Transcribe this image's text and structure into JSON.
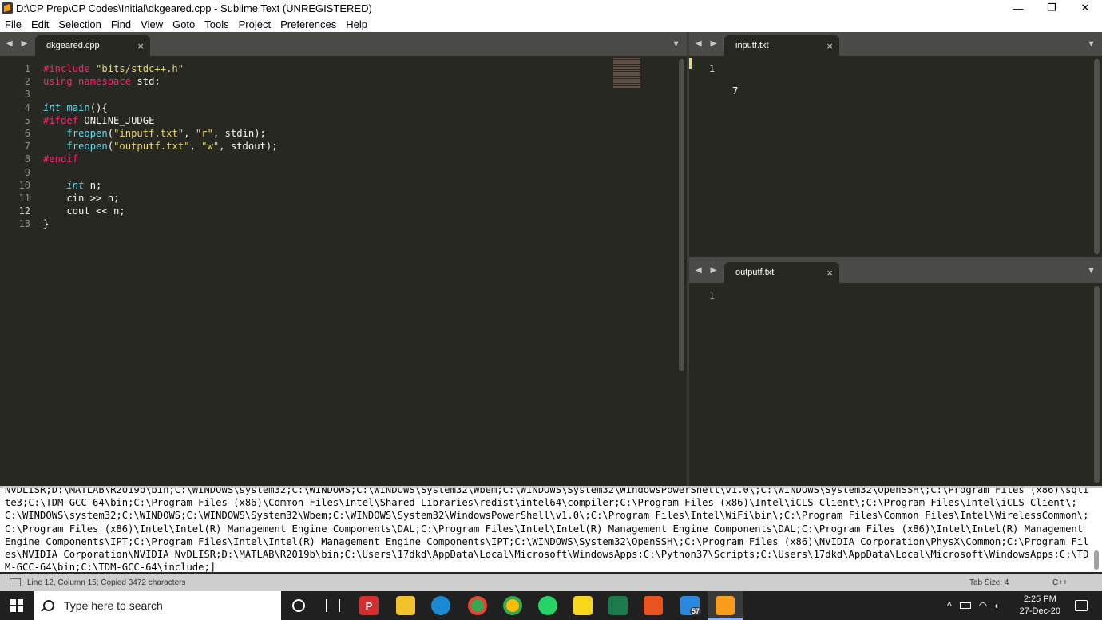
{
  "window": {
    "title": "D:\\CP Prep\\CP Codes\\Initial\\dkgeared.cpp - Sublime Text (UNREGISTERED)",
    "minimize": "—",
    "maximize": "❐",
    "close": "✕"
  },
  "menu": [
    "File",
    "Edit",
    "Selection",
    "Find",
    "View",
    "Goto",
    "Tools",
    "Project",
    "Preferences",
    "Help"
  ],
  "left_pane": {
    "nav": "◀ ▶",
    "tab_label": "dkgeared.cpp",
    "tab_close": "×",
    "dropdown": "▼",
    "line_numbers": [
      "1",
      "2",
      "3",
      "4",
      "5",
      "6",
      "7",
      "8",
      "9",
      "10",
      "11",
      "12",
      "13"
    ],
    "active_line": 12
  },
  "input_pane": {
    "nav": "◀ ▶",
    "tab_label": "inputf.txt",
    "tab_close": "×",
    "dropdown": "▼",
    "line_numbers": [
      "1"
    ],
    "content": "7"
  },
  "output_pane": {
    "nav": "◀ ▶",
    "tab_label": "outputf.txt",
    "tab_close": "×",
    "dropdown": "▼",
    "line_numbers": [
      "1"
    ],
    "content": ""
  },
  "code_lines": [
    [
      {
        "t": "#include ",
        "c": "pp"
      },
      {
        "t": "\"bits/stdc++.h\"",
        "c": "st"
      }
    ],
    [
      {
        "t": "using ",
        "c": "kw"
      },
      {
        "t": "namespace ",
        "c": "kw"
      },
      {
        "t": "std;",
        "c": ""
      }
    ],
    [],
    [
      {
        "t": "int",
        "c": "ty"
      },
      {
        "t": " ",
        "c": ""
      },
      {
        "t": "main",
        "c": "fn"
      },
      {
        "t": "(){",
        "c": ""
      }
    ],
    [
      {
        "t": "#ifdef ",
        "c": "pp"
      },
      {
        "t": "ONLINE_JUDGE",
        "c": ""
      }
    ],
    [
      {
        "t": "    ",
        "c": ""
      },
      {
        "t": "freopen",
        "c": "fn"
      },
      {
        "t": "(",
        "c": ""
      },
      {
        "t": "\"inputf.txt\"",
        "c": "st"
      },
      {
        "t": ", ",
        "c": ""
      },
      {
        "t": "\"r\"",
        "c": "st"
      },
      {
        "t": ", stdin);",
        "c": ""
      }
    ],
    [
      {
        "t": "    ",
        "c": ""
      },
      {
        "t": "freopen",
        "c": "fn"
      },
      {
        "t": "(",
        "c": ""
      },
      {
        "t": "\"outputf.txt\"",
        "c": "st"
      },
      {
        "t": ", ",
        "c": ""
      },
      {
        "t": "\"w\"",
        "c": "st"
      },
      {
        "t": ", stdout);",
        "c": ""
      }
    ],
    [
      {
        "t": "#endif",
        "c": "pp"
      }
    ],
    [],
    [
      {
        "t": "    ",
        "c": ""
      },
      {
        "t": "int",
        "c": "ty"
      },
      {
        "t": " n;",
        "c": ""
      }
    ],
    [
      {
        "t": "    cin >> n;",
        "c": ""
      }
    ],
    [
      {
        "t": "    cout << n;",
        "c": ""
      }
    ],
    [
      {
        "t": "}",
        "c": ""
      }
    ]
  ],
  "console": {
    "text": "NvDLISR;D:\\MATLAB\\R2019b\\bin;C:\\WINDOWS\\system32;C:\\WINDOWS;C:\\WINDOWS\\System32\\Wbem;C:\\WINDOWS\\System32\\WindowsPowerShell\\v1.0\\;C:\\WINDOWS\\System32\\OpenSSH\\;C:\\Program Files (x86)\\sqlite3;C:\\TDM-GCC-64\\bin;C:\\Program Files (x86)\\Common Files\\Intel\\Shared Libraries\\redist\\intel64\\compiler;C:\\Program Files (x86)\\Intel\\iCLS Client\\;C:\\Program Files\\Intel\\iCLS Client\\;C:\\WINDOWS\\system32;C:\\WINDOWS;C:\\WINDOWS\\System32\\Wbem;C:\\WINDOWS\\System32\\WindowsPowerShell\\v1.0\\;C:\\Program Files\\Intel\\WiFi\\bin\\;C:\\Program Files\\Common Files\\Intel\\WirelessCommon\\;C:\\Program Files (x86)\\Intel\\Intel(R) Management Engine Components\\DAL;C:\\Program Files\\Intel\\Intel(R) Management Engine Components\\DAL;C:\\Program Files (x86)\\Intel\\Intel(R) Management Engine Components\\IPT;C:\\Program Files\\Intel\\Intel(R) Management Engine Components\\IPT;C:\\WINDOWS\\System32\\OpenSSH\\;C:\\Program Files (x86)\\NVIDIA Corporation\\PhysX\\Common;C:\\Program Files\\NVIDIA Corporation\\NVIDIA NvDLISR;D:\\MATLAB\\R2019b\\bin;C:\\Users\\17dkd\\AppData\\Local\\Microsoft\\WindowsApps;C:\\Python37\\Scripts;C:\\Users\\17dkd\\AppData\\Local\\Microsoft\\WindowsApps;C:\\TDM-GCC-64\\bin;C:\\TDM-GCC-64\\include;]"
  },
  "status": {
    "left": "Line 12, Column 15; Copied 3472 characters",
    "tab_size": "Tab Size: 4",
    "syntax": "C++"
  },
  "taskbar": {
    "search_placeholder": "Type here to search",
    "badge": "57",
    "time": "2:25 PM",
    "date": "27-Dec-20"
  },
  "colors": {
    "editor_bg": "#272822",
    "keyword": "#f92672",
    "type": "#66d9ef",
    "string": "#e6db74",
    "accent": "#f89c1c"
  }
}
